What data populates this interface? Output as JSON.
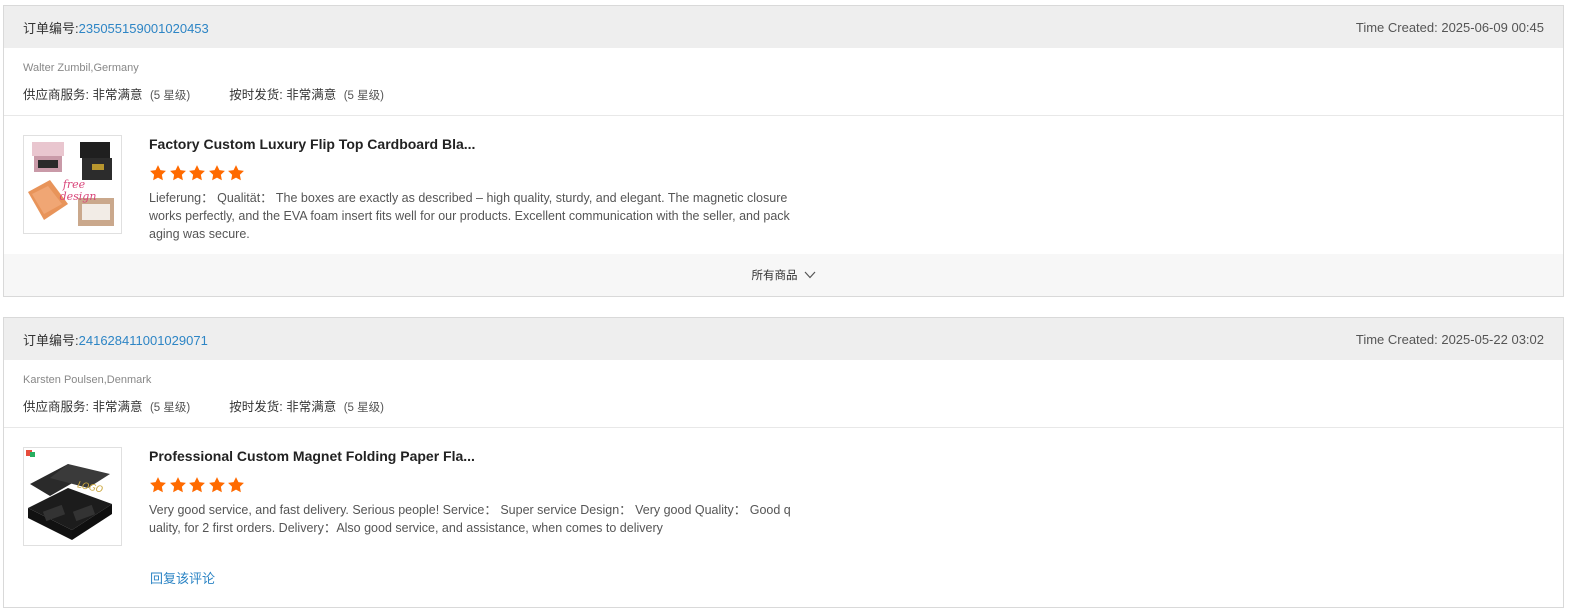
{
  "orders": [
    {
      "order_label": "订单编号:",
      "order_number": "235055159001020453",
      "time_created": "Time Created: 2025-06-09 00:45",
      "buyer": "Walter Zumbil,Germany",
      "supplier_service_label": "供应商服务:",
      "supplier_service_value": "非常满意",
      "supplier_service_level": "(5 星级)",
      "on_time_label": "按时发货:",
      "on_time_value": "非常满意",
      "on_time_level": "(5 星级)",
      "product_title": "Factory Custom Luxury Flip Top Cardboard Bla...",
      "product_image_text": "free design",
      "stars": 5,
      "review": "Lieferung： Qualität： The boxes are exactly as described – high quality, sturdy, and elegant. The magnetic closure works perfectly, and the EVA foam insert fits well for our products. Excellent communication with the seller, and packaging was secure.",
      "footer_label": "所有商品"
    },
    {
      "order_label": "订单编号:",
      "order_number": "241628411001029071",
      "time_created": "Time Created: 2025-05-22 03:02",
      "buyer": "Karsten Poulsen,Denmark",
      "supplier_service_label": "供应商服务:",
      "supplier_service_value": "非常满意",
      "supplier_service_level": "(5 星级)",
      "on_time_label": "按时发货:",
      "on_time_value": "非常满意",
      "on_time_level": "(5 星级)",
      "product_title": "Professional Custom Magnet Folding Paper Fla...",
      "product_image_text": "LOGO",
      "stars": 5,
      "review": "Very good service, and fast delivery. Serious people! Service： Super service Design： Very good Quality： Good quality, for 2 first orders. Delivery：Also good service, and assistance, when comes to delivery",
      "reply_label": "回复该评论"
    }
  ],
  "colors": {
    "link": "#2d85c5",
    "star": "#ff6a00",
    "header_bg": "#eeeeee"
  },
  "icons": {
    "star": "star-icon",
    "chevron": "chevron-down-icon"
  }
}
